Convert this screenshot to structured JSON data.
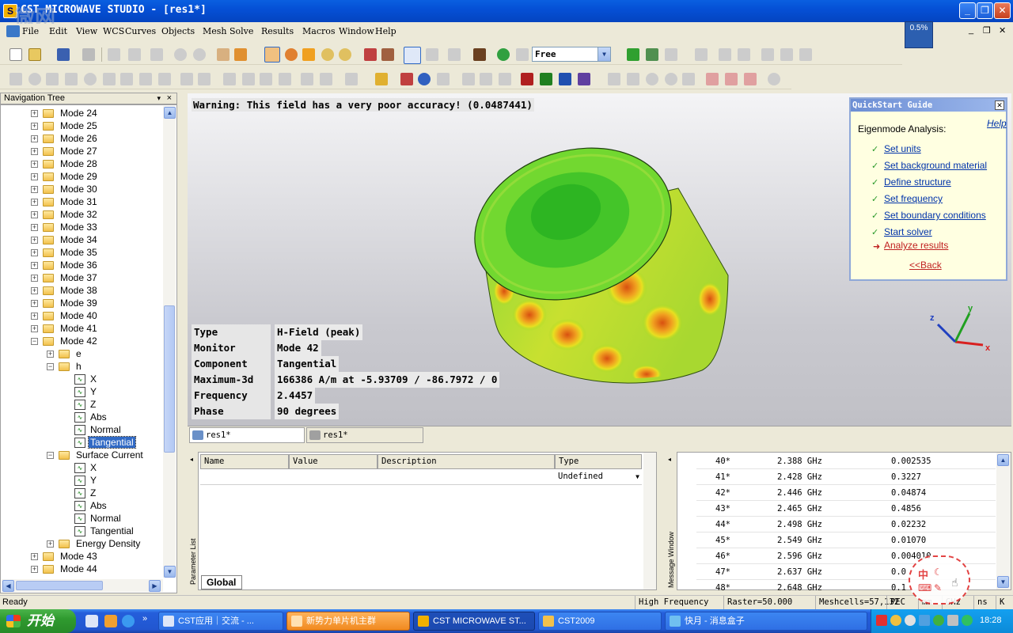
{
  "window": {
    "title": "CST MICROWAVE STUDIO - [res1*]",
    "watermark": "微网",
    "progress_pct": "0.5%"
  },
  "menu": [
    "File",
    "Edit",
    "View",
    "WCS",
    "Curves",
    "Objects",
    "Mesh",
    "Solve",
    "Results",
    "Macros",
    "Window",
    "Help"
  ],
  "toolbar": {
    "view_mode": "Free"
  },
  "nav": {
    "header": "Navigation Tree",
    "close": "×",
    "modes_before": [
      "Mode 24",
      "Mode 25",
      "Mode 26",
      "Mode 27",
      "Mode 28",
      "Mode 29",
      "Mode 30",
      "Mode 31",
      "Mode 32",
      "Mode 33",
      "Mode 34",
      "Mode 35",
      "Mode 36",
      "Mode 37",
      "Mode 38",
      "Mode 39",
      "Mode 40",
      "Mode 41"
    ],
    "expanded_mode": "Mode 42",
    "e_label": "e",
    "h_label": "h",
    "h_children": [
      "X",
      "Y",
      "Z",
      "Abs",
      "Normal",
      "Tangential"
    ],
    "selected": "Tangential",
    "surface_current": "Surface Current",
    "sc_children": [
      "X",
      "Y",
      "Z",
      "Abs",
      "Normal",
      "Tangential"
    ],
    "energy_density": "Energy Density",
    "modes_after": [
      "Mode 43",
      "Mode 44"
    ]
  },
  "view": {
    "warning": "Warning: This field has a very poor accuracy! (0.0487441)",
    "info": [
      {
        "k": "Type",
        "v": "H-Field (peak)"
      },
      {
        "k": "Monitor",
        "v": "Mode 42"
      },
      {
        "k": "Component",
        "v": "Tangential"
      },
      {
        "k": "Maximum-3d",
        "v": "166386 A/m at -5.93709 / -86.7972 / 0"
      },
      {
        "k": "Frequency",
        "v": "2.4457"
      },
      {
        "k": "Phase",
        "v": "90 degrees"
      }
    ],
    "axes": {
      "x": "x",
      "y": "y",
      "z": "z"
    }
  },
  "quickstart": {
    "title": "QuickStart Guide",
    "heading": "Eigenmode Analysis:",
    "help": "Help",
    "steps": [
      "Set units",
      "Set background material",
      "Define structure",
      "Set frequency",
      "Set boundary conditions",
      "Start solver"
    ],
    "current": "Analyze results",
    "back": "<<Back"
  },
  "tabs": [
    "res1*",
    "res1*"
  ],
  "param": {
    "side_label": "Parameter List",
    "cols": [
      "Name",
      "Value",
      "Description",
      "Type"
    ],
    "type_value": "Undefined",
    "tab": "Global"
  },
  "msg": {
    "side_label": "Message Window",
    "rows": [
      {
        "n": "40*",
        "f": "2.388 GHz",
        "v": "0.002535"
      },
      {
        "n": "41*",
        "f": "2.428 GHz",
        "v": "0.3227"
      },
      {
        "n": "42*",
        "f": "2.446 GHz",
        "v": "0.04874"
      },
      {
        "n": "43*",
        "f": "2.465 GHz",
        "v": "0.4856"
      },
      {
        "n": "44*",
        "f": "2.498 GHz",
        "v": "0.02232"
      },
      {
        "n": "45*",
        "f": "2.549 GHz",
        "v": "0.01070"
      },
      {
        "n": "46*",
        "f": "2.596 GHz",
        "v": "0.004010"
      },
      {
        "n": "47*",
        "f": "2.637 GHz",
        "v": "0.0"
      },
      {
        "n": "48*",
        "f": "2.648 GHz",
        "v": "0.1"
      }
    ]
  },
  "status": {
    "left": "Ready",
    "freq": "High Frequency",
    "raster": "Raster=50.000",
    "mesh": "Meshcells=57,132",
    "bc": "PEC",
    "units": "mm",
    "ghz": "GHz",
    "ns": "ns",
    "k": "K"
  },
  "taskbar": {
    "start": "开始",
    "items": [
      "CST应用｜交流 - ...",
      "新势力单片机主群",
      "CST MICROWAVE ST...",
      "CST2009",
      "快月 - 消息盒子"
    ],
    "clock": "18:28",
    "ime": "中"
  }
}
